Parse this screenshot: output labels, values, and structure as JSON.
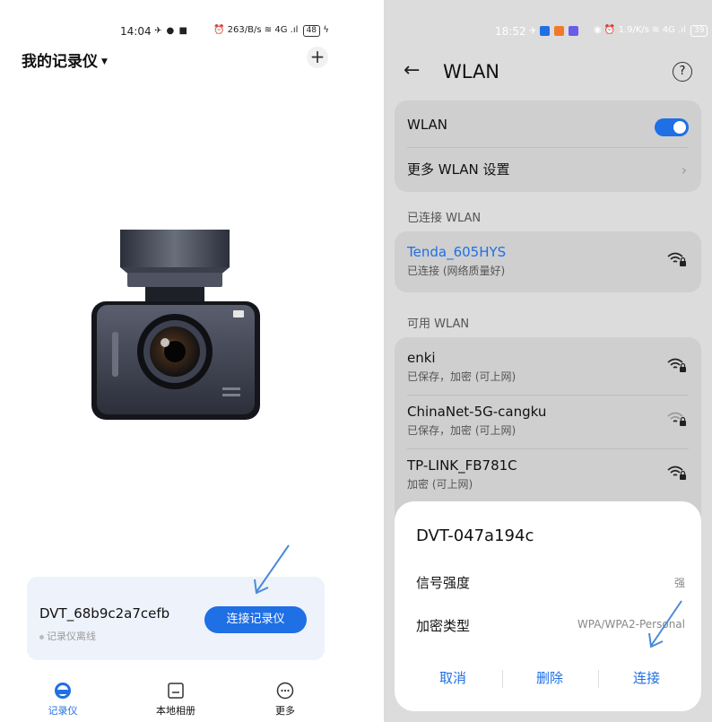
{
  "left": {
    "status": {
      "time": "14:04",
      "net_speed_top": "263",
      "net_speed_bottom": "B/s",
      "signal": "4G",
      "battery": "48"
    },
    "title": "我的记录仪",
    "device": {
      "name": "DVT_68b9c2a7cefb",
      "status": "记录仪离线",
      "connect_label": "连接记录仪"
    },
    "nav": [
      {
        "label": "记录仪",
        "icon": "recorder-icon",
        "active": true
      },
      {
        "label": "本地相册",
        "icon": "album-icon",
        "active": false
      },
      {
        "label": "更多",
        "icon": "more-icon",
        "active": false
      }
    ]
  },
  "right": {
    "status": {
      "time": "18:52",
      "net_speed_top": "1.9",
      "net_speed_bottom": "K/s",
      "signal": "4G",
      "battery": "39"
    },
    "header": {
      "title": "WLAN",
      "help": "?"
    },
    "wlan_toggle_label": "WLAN",
    "wlan_enabled": true,
    "more_settings": "更多 WLAN 设置",
    "section_connected": "已连接 WLAN",
    "connected": {
      "ssid": "Tenda_605HYS",
      "status": "已连接 (网络质量好)"
    },
    "section_available": "可用 WLAN",
    "available": [
      {
        "ssid": "enki",
        "status": "已保存，加密 (可上网)"
      },
      {
        "ssid": "ChinaNet-5G-cangku",
        "status": "已保存，加密 (可上网)"
      },
      {
        "ssid": "TP-LINK_FB781C",
        "status": "加密 (可上网)"
      }
    ],
    "dialog": {
      "title": "DVT-047a194c",
      "signal_label": "信号强度",
      "signal_value": "强",
      "encryption_label": "加密类型",
      "encryption_value": "WPA/WPA2-Personal",
      "cancel": "取消",
      "delete": "删除",
      "connect": "连接"
    }
  },
  "colors": {
    "accent": "#1f6fe5",
    "annotation_arrow": "#4a8ad8"
  }
}
